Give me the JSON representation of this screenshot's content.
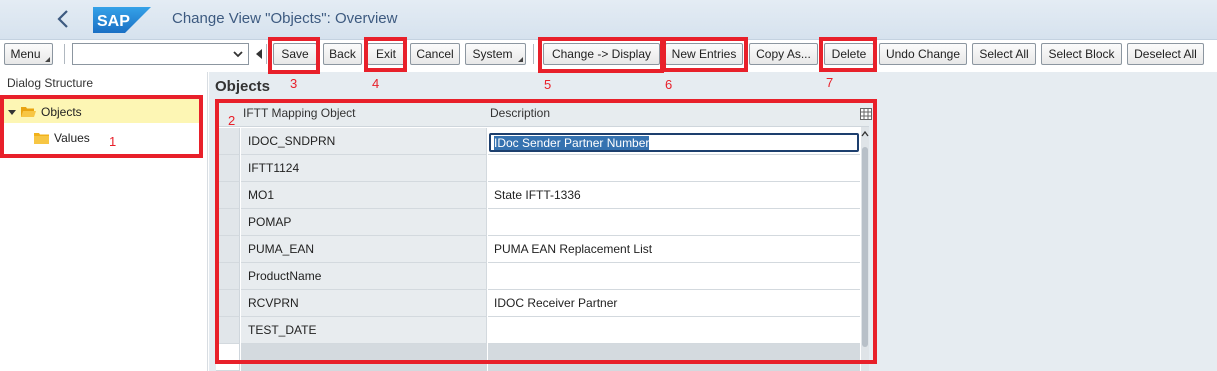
{
  "window": {
    "title": "Change View \"Objects\": Overview",
    "logo_text": "SAP"
  },
  "toolbar": {
    "menu_label": "Menu",
    "command_field_value": "",
    "save_label": "Save",
    "back_label": "Back",
    "exit_label": "Exit",
    "cancel_label": "Cancel",
    "system_label": "System",
    "change_display_label": "Change -> Display",
    "new_entries_label": "New Entries",
    "copy_as_label": "Copy As...",
    "delete_label": "Delete",
    "undo_change_label": "Undo Change",
    "select_all_label": "Select All",
    "select_block_label": "Select Block",
    "deselect_all_label": "Deselect All"
  },
  "dialog_structure": {
    "header": "Dialog Structure",
    "items": [
      {
        "label": "Objects",
        "selected": true,
        "expanded": true
      },
      {
        "label": "Values",
        "selected": false
      }
    ]
  },
  "main": {
    "title": "Objects",
    "columns": [
      "IFTT Mapping Object",
      "Description"
    ],
    "rows": [
      {
        "object": "IDOC_SNDPRN",
        "description": "IDoc Sender Partner Number"
      },
      {
        "object": "IFTT1124",
        "description": ""
      },
      {
        "object": "MO1",
        "description": "State IFTT-1336"
      },
      {
        "object": "POMAP",
        "description": ""
      },
      {
        "object": "PUMA_EAN",
        "description": "PUMA EAN Replacement List"
      },
      {
        "object": "ProductName",
        "description": ""
      },
      {
        "object": "RCVPRN",
        "description": "IDOC Receiver Partner"
      },
      {
        "object": "TEST_DATE",
        "description": ""
      }
    ]
  },
  "annotations": {
    "color": "#e8202a",
    "labels": [
      "1",
      "2",
      "3",
      "4",
      "5",
      "6",
      "7"
    ]
  },
  "colors": {
    "title_text": "#3d5a80",
    "sap_blue": "#1a6fc4",
    "tree_selected_bg": "#fdf6b4",
    "folder": "#f2b21a"
  }
}
